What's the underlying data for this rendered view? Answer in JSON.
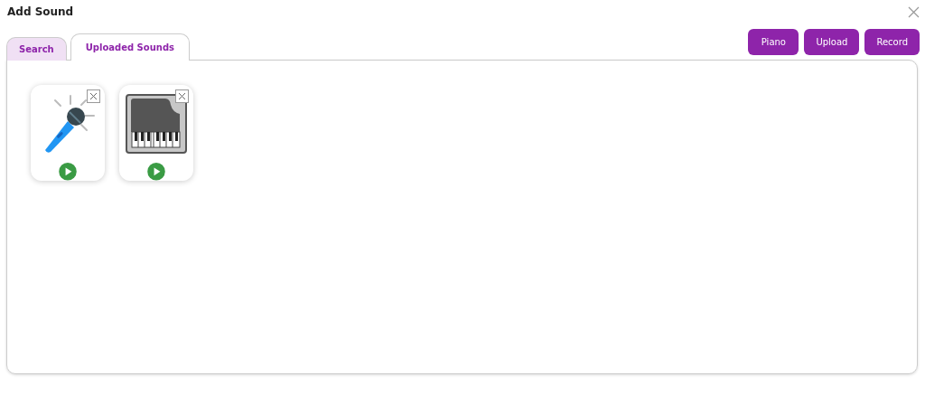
{
  "window": {
    "title": "Add Sound"
  },
  "tabs": [
    {
      "label": "Search",
      "selected": false
    },
    {
      "label": "Uploaded Sounds",
      "selected": true
    }
  ],
  "buttons": [
    "Piano",
    "Upload",
    "Record"
  ],
  "sounds": [
    {
      "kind": "microphone"
    },
    {
      "kind": "piano"
    }
  ]
}
